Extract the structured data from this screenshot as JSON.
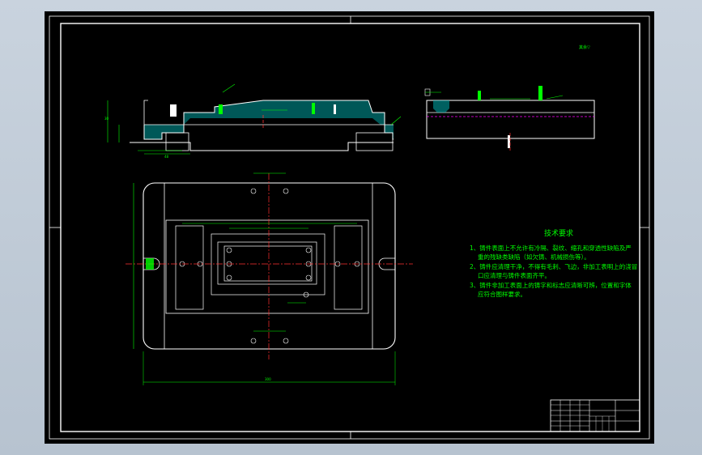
{
  "technical_requirements": {
    "title": "技术要求",
    "lines": [
      "1、铸件表面上不允许有冷隔、裂纹、缩孔和穿透性缺陷及严",
      "重的残缺类缺陷（如欠铸、机械损伤等）。",
      "2、铸件应清理干净，不得有毛刺、飞边，非加工表明上的浇冒",
      "口应清理与铸件表面齐平。",
      "3、铸件非加工表面上的铸字和标志应清晰可辨，位置和字体",
      "应符合图样要求。"
    ]
  },
  "roughness_note": "其余▽",
  "colors": {
    "background": "#000000",
    "outline": "#ffffff",
    "dimension": "#00ff00",
    "centerline": "#ff3030",
    "hatch": "#00c8c8",
    "hidden": "#ff00ff",
    "window": "#c4cfdb"
  }
}
